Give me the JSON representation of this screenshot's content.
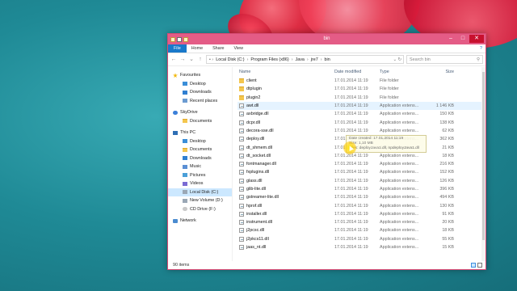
{
  "window": {
    "title": "bin"
  },
  "ribbon": {
    "file": "File",
    "tabs": [
      "Home",
      "Share",
      "View"
    ]
  },
  "address": {
    "crumbs": [
      "Local Disk (C:)",
      "Program Files (x86)",
      "Java",
      "jre7",
      "bin"
    ],
    "search_placeholder": "Search bin"
  },
  "nav": {
    "favourites": {
      "label": "Favourites",
      "items": [
        "Desktop",
        "Downloads",
        "Recent places"
      ]
    },
    "skydrive": {
      "label": "SkyDrive",
      "items": [
        "Documents"
      ]
    },
    "thispc": {
      "label": "This PC",
      "items": [
        "Desktop",
        "Documents",
        "Downloads",
        "Music",
        "Pictures",
        "Videos",
        "Local Disk (C:)",
        "New Volume (D:)",
        "CD Drive (F:)"
      ]
    },
    "network": {
      "label": "Network"
    }
  },
  "columns": {
    "name": "Name",
    "date": "Date modified",
    "type": "Type",
    "size": "Size"
  },
  "files": [
    {
      "name": "client",
      "date": "17.01.2014 11:19",
      "type": "File folder",
      "size": "",
      "kind": "folder"
    },
    {
      "name": "dtplugin",
      "date": "17.01.2014 11:19",
      "type": "File folder",
      "size": "",
      "kind": "folder"
    },
    {
      "name": "plugin2",
      "date": "17.01.2014 11:19",
      "type": "File folder",
      "size": "",
      "kind": "folder"
    },
    {
      "name": "awt.dll",
      "date": "17.01.2014 11:19",
      "type": "Application extens...",
      "size": "1 146 KB",
      "kind": "dll"
    },
    {
      "name": "axbridge.dll",
      "date": "17.01.2014 11:19",
      "type": "Application extens...",
      "size": "150 KB",
      "kind": "dll"
    },
    {
      "name": "dcpr.dll",
      "date": "17.01.2014 11:19",
      "type": "Application extens...",
      "size": "138 KB",
      "kind": "dll"
    },
    {
      "name": "decora-sse.dll",
      "date": "17.01.2014 11:19",
      "type": "Application extens...",
      "size": "62 KB",
      "kind": "dll"
    },
    {
      "name": "deploy.dll",
      "date": "17.01.2014 11:19",
      "type": "Application extens...",
      "size": "362 KB",
      "kind": "dll"
    },
    {
      "name": "dt_shmem.dll",
      "date": "17.01.2014 11:19",
      "type": "Application extens...",
      "size": "21 KB",
      "kind": "dll"
    },
    {
      "name": "dt_socket.dll",
      "date": "17.01.2014 11:19",
      "type": "Application extens...",
      "size": "18 KB",
      "kind": "dll"
    },
    {
      "name": "fontmanager.dll",
      "date": "17.01.2014 11:19",
      "type": "Application extens...",
      "size": "216 KB",
      "kind": "dll"
    },
    {
      "name": "fxplugins.dll",
      "date": "17.01.2014 11:19",
      "type": "Application extens...",
      "size": "152 KB",
      "kind": "dll"
    },
    {
      "name": "glass.dll",
      "date": "17.01.2014 11:19",
      "type": "Application extens...",
      "size": "126 KB",
      "kind": "dll"
    },
    {
      "name": "glib-lite.dll",
      "date": "17.01.2014 11:19",
      "type": "Application extens...",
      "size": "396 KB",
      "kind": "dll"
    },
    {
      "name": "gstreamer-lite.dll",
      "date": "17.01.2014 11:19",
      "type": "Application extens...",
      "size": "494 KB",
      "kind": "dll"
    },
    {
      "name": "hprof.dll",
      "date": "17.01.2014 11:19",
      "type": "Application extens...",
      "size": "130 KB",
      "kind": "dll"
    },
    {
      "name": "installer.dll",
      "date": "17.01.2014 11:19",
      "type": "Application extens...",
      "size": "91 KB",
      "kind": "dll"
    },
    {
      "name": "instrument.dll",
      "date": "17.01.2014 11:19",
      "type": "Application extens...",
      "size": "20 KB",
      "kind": "dll"
    },
    {
      "name": "j2pcsc.dll",
      "date": "17.01.2014 11:19",
      "type": "Application extens...",
      "size": "18 KB",
      "kind": "dll"
    },
    {
      "name": "j2pkcs11.dll",
      "date": "17.01.2014 11:19",
      "type": "Application extens...",
      "size": "55 KB",
      "kind": "dll"
    },
    {
      "name": "jaas_nt.dll",
      "date": "17.01.2014 11:19",
      "type": "Application extens...",
      "size": "15 KB",
      "kind": "dll"
    }
  ],
  "tooltip": {
    "line1": "Date created: 17.01.2014 11:19",
    "line2": "Size: 1,10 MB",
    "line3": "Files: deployJava1.dll, npdeployJava1.dll"
  },
  "status": {
    "items_count": "90 items"
  }
}
